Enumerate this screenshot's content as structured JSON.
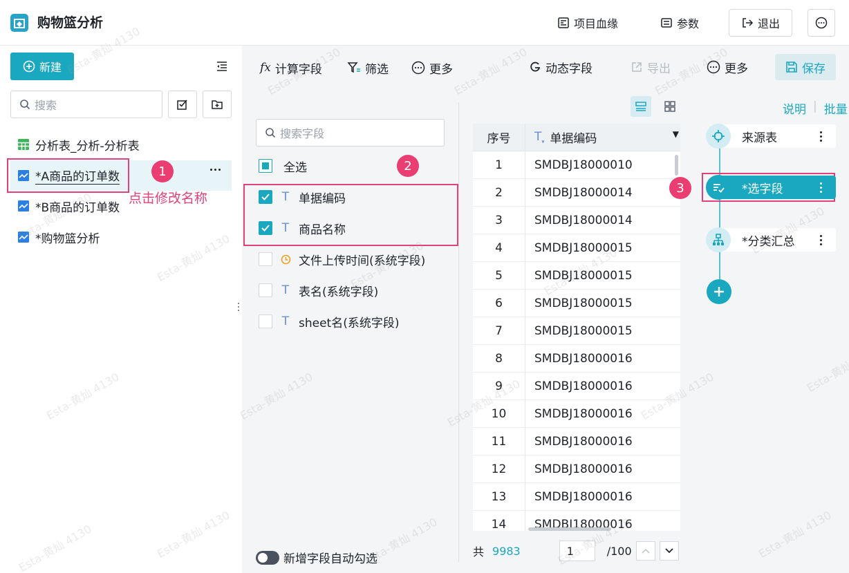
{
  "header": {
    "title": "购物篮分析",
    "lineage_label": "项目血缘",
    "params_label": "参数",
    "logout_label": "退出"
  },
  "left": {
    "new_label": "新建",
    "search_placeholder": "搜索",
    "items": [
      {
        "label": "分析表_分析-分析表"
      },
      {
        "label": "*A商品的订单数"
      },
      {
        "label": "*B商品的订单数"
      },
      {
        "label": "*购物篮分析"
      }
    ],
    "annotation_badge": "1",
    "annotation_text": "点击修改名称"
  },
  "toolbar": {
    "calc_field": "计算字段",
    "filter": "筛选",
    "more_left": "更多",
    "dynamic_field": "动态字段",
    "export": "导出",
    "more_right": "更多",
    "save": "保存"
  },
  "fields": {
    "search_placeholder": "搜索字段",
    "select_all": "全选",
    "badge": "2",
    "items": [
      {
        "label": "单据编码",
        "checked": true,
        "icon": "text-type-icon"
      },
      {
        "label": "商品名称",
        "checked": true,
        "icon": "text-type-icon"
      },
      {
        "label": "文件上传时间(系统字段)",
        "checked": false,
        "icon": "clock-icon"
      },
      {
        "label": "表名(系统字段)",
        "checked": false,
        "icon": "text-type-icon"
      },
      {
        "label": "sheet名(系统字段)",
        "checked": false,
        "icon": "text-type-icon"
      }
    ],
    "auto_check_label": "新增字段自动勾选"
  },
  "table": {
    "col_index": "序号",
    "col_code": "单据编码",
    "rows": [
      [
        "1",
        "SMDBJ18000010"
      ],
      [
        "2",
        "SMDBJ18000014"
      ],
      [
        "3",
        "SMDBJ18000014"
      ],
      [
        "4",
        "SMDBJ18000015"
      ],
      [
        "5",
        "SMDBJ18000015"
      ],
      [
        "6",
        "SMDBJ18000015"
      ],
      [
        "7",
        "SMDBJ18000015"
      ],
      [
        "8",
        "SMDBJ18000016"
      ],
      [
        "9",
        "SMDBJ18000016"
      ],
      [
        "10",
        "SMDBJ18000016"
      ],
      [
        "11",
        "SMDBJ18000016"
      ],
      [
        "12",
        "SMDBJ18000016"
      ],
      [
        "13",
        "SMDBJ18000016"
      ],
      [
        "14",
        "SMDBJ18000016"
      ]
    ],
    "total_prefix": "共",
    "total": "9983",
    "page": "1",
    "page_total": "/100"
  },
  "flow": {
    "help": "说明",
    "batch": "批量",
    "nodes": [
      {
        "label": "来源表"
      },
      {
        "label": "*选字段"
      },
      {
        "label": "*分类汇总"
      }
    ],
    "badge": "3"
  },
  "watermark": "Esta-黄灿 4130",
  "colors": {
    "accent": "#1aa8c0",
    "annotation": "#ea3d72"
  }
}
